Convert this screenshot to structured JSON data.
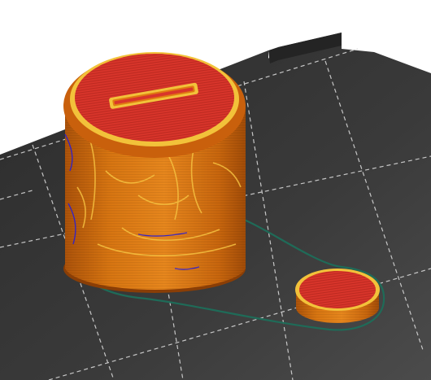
{
  "viewport": {
    "background": "#ffffff",
    "bed_color": "#2a2a2a",
    "bed_highlight": "#4a4a4a",
    "grid_color": "#d8d8d8"
  },
  "preview": {
    "objects": [
      {
        "name": "coin-bank-body",
        "wall_color": "#e07a12",
        "top_color": "#d9352b",
        "slot": true
      },
      {
        "name": "coin-bank-lid",
        "wall_color": "#e07a12",
        "top_color": "#d9352b"
      }
    ],
    "skirt_color": "#1f6b58",
    "perimeter_highlight_color": "#f2c23a",
    "overhang_color": "#2b1fd1"
  }
}
